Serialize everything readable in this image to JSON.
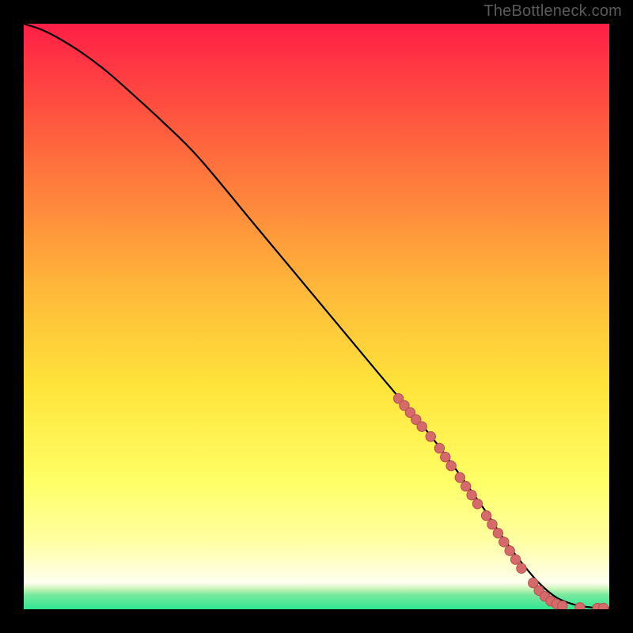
{
  "attribution": "TheBottleneck.com",
  "colors": {
    "page_bg": "#000000",
    "gradient_top": "#ff1f46",
    "gradient_mid_upper": "#ff8a3a",
    "gradient_mid": "#ffd53a",
    "gradient_mid_lower": "#ffff66",
    "gradient_lower": "#ffffa0",
    "gradient_lowest": "#ffffe0",
    "gradient_bottom": "#2fe68f",
    "curve": "#000000",
    "marker_fill": "#d46a6a",
    "marker_stroke": "#b84f4f",
    "attribution_text": "#5a5a5a"
  },
  "chart_data": {
    "type": "line",
    "title": "",
    "xlabel": "",
    "ylabel": "",
    "xlim": [
      0,
      100
    ],
    "ylim": [
      0,
      100
    ],
    "grid": false,
    "legend": false,
    "series": [
      {
        "name": "curve",
        "x": [
          0,
          3,
          6,
          10,
          14,
          18,
          24,
          30,
          40,
          50,
          60,
          70,
          78,
          82,
          85,
          88,
          91,
          94,
          97,
          100
        ],
        "y": [
          100,
          99,
          97.5,
          95,
          92,
          88.5,
          83,
          77,
          65,
          53,
          41,
          29,
          18,
          12,
          8,
          4.5,
          2,
          0.8,
          0.3,
          0.2
        ]
      }
    ],
    "markers": [
      {
        "x": 64.0,
        "y": 36.0
      },
      {
        "x": 65.0,
        "y": 34.8
      },
      {
        "x": 66.0,
        "y": 33.6
      },
      {
        "x": 67.0,
        "y": 32.4
      },
      {
        "x": 68.0,
        "y": 31.2
      },
      {
        "x": 69.5,
        "y": 29.5
      },
      {
        "x": 71.0,
        "y": 27.5
      },
      {
        "x": 72.0,
        "y": 26.0
      },
      {
        "x": 73.0,
        "y": 24.5
      },
      {
        "x": 74.5,
        "y": 22.5
      },
      {
        "x": 75.5,
        "y": 21.0
      },
      {
        "x": 76.5,
        "y": 19.5
      },
      {
        "x": 77.5,
        "y": 18.0
      },
      {
        "x": 79.0,
        "y": 16.0
      },
      {
        "x": 80.0,
        "y": 14.5
      },
      {
        "x": 81.0,
        "y": 13.0
      },
      {
        "x": 82.0,
        "y": 11.5
      },
      {
        "x": 83.0,
        "y": 10.0
      },
      {
        "x": 84.0,
        "y": 8.5
      },
      {
        "x": 85.0,
        "y": 7.0
      },
      {
        "x": 87.0,
        "y": 4.5
      },
      {
        "x": 88.0,
        "y": 3.2
      },
      {
        "x": 89.0,
        "y": 2.2
      },
      {
        "x": 90.0,
        "y": 1.4
      },
      {
        "x": 91.0,
        "y": 0.9
      },
      {
        "x": 92.0,
        "y": 0.6
      },
      {
        "x": 95.0,
        "y": 0.3
      },
      {
        "x": 98.0,
        "y": 0.2
      },
      {
        "x": 99.0,
        "y": 0.2
      }
    ]
  }
}
